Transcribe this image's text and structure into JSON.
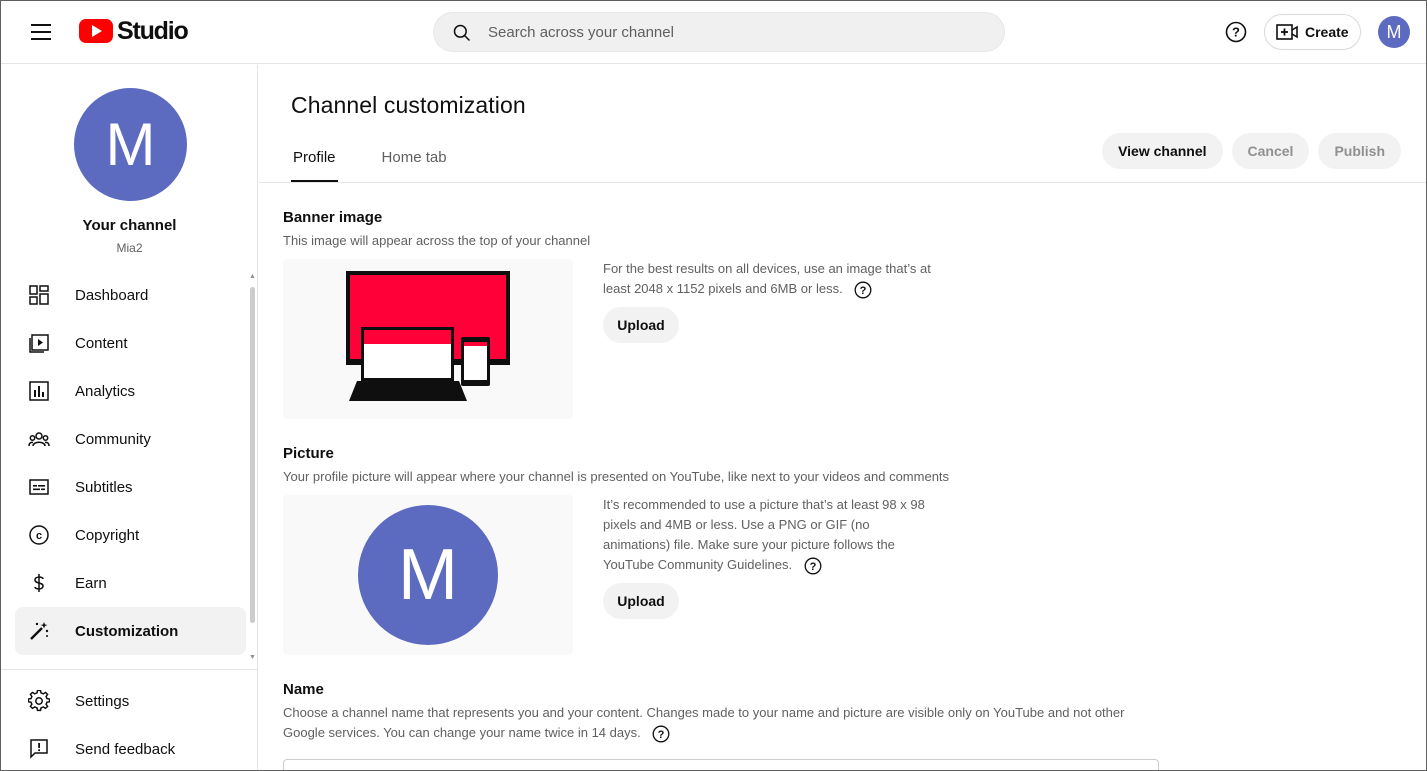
{
  "app": {
    "brand": "Studio",
    "accent": "#ff0000",
    "avatar_color": "#5c6bc0"
  },
  "header": {
    "search_placeholder": "Search across your channel",
    "create_label": "Create",
    "avatar_initial": "M"
  },
  "sidebar": {
    "avatar_initial": "M",
    "channel_title": "Your channel",
    "channel_handle": "Mia2",
    "items": [
      {
        "label": "Dashboard",
        "icon": "dashboard-icon"
      },
      {
        "label": "Content",
        "icon": "content-icon"
      },
      {
        "label": "Analytics",
        "icon": "analytics-icon"
      },
      {
        "label": "Community",
        "icon": "community-icon"
      },
      {
        "label": "Subtitles",
        "icon": "subtitles-icon"
      },
      {
        "label": "Copyright",
        "icon": "copyright-icon"
      },
      {
        "label": "Earn",
        "icon": "earn-icon"
      },
      {
        "label": "Customization",
        "icon": "customization-icon",
        "active": true
      }
    ],
    "bottom_items": [
      {
        "label": "Settings",
        "icon": "gear-icon"
      },
      {
        "label": "Send feedback",
        "icon": "feedback-icon"
      }
    ]
  },
  "main": {
    "title": "Channel customization",
    "tabs": [
      {
        "label": "Profile",
        "active": true
      },
      {
        "label": "Home tab",
        "active": false
      }
    ],
    "actions": {
      "view_channel": "View channel",
      "cancel": "Cancel",
      "publish": "Publish"
    },
    "banner": {
      "title": "Banner image",
      "description": "This image will appear across the top of your channel",
      "hint": "For the best results on all devices, use an image that’s at least 2048 x 1152 pixels and 6MB or less.",
      "upload_label": "Upload"
    },
    "picture": {
      "title": "Picture",
      "description": "Your profile picture will appear where your channel is presented on YouTube, like next to your videos and comments",
      "hint": "It’s recommended to use a picture that’s at least 98 x 98 pixels and 4MB or less. Use a PNG or GIF (no animations) file. Make sure your picture follows the YouTube Community Guidelines.",
      "upload_label": "Upload",
      "avatar_initial": "M"
    },
    "name": {
      "title": "Name",
      "description": "Choose a channel name that represents you and your content. Changes made to your name and picture are visible only on YouTube and not other Google services. You can change your name twice in 14 days."
    }
  }
}
